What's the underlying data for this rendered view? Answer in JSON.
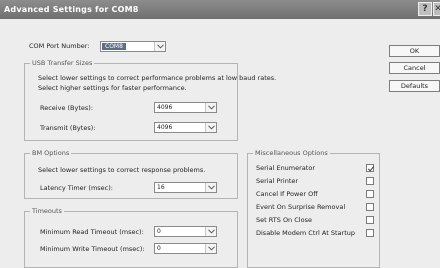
{
  "window": {
    "title": "Advanced Settings for COM8"
  },
  "titlebar_buttons": {
    "help": "?",
    "close": "✕"
  },
  "port": {
    "label": "COM Port Number:",
    "value": "COM8"
  },
  "usb": {
    "title": "USB Transfer Sizes",
    "desc1": "Select lower settings to correct performance problems at low baud rates.",
    "desc2": "Select higher settings for faster performance.",
    "receive_label": "Receive (Bytes):",
    "receive_value": "4096",
    "transmit_label": "Transmit (Bytes):",
    "transmit_value": "4096"
  },
  "bm": {
    "title": "BM Options",
    "desc": "Select lower settings to correct response problems.",
    "latency_label": "Latency Timer (msec):",
    "latency_value": "16"
  },
  "timeouts": {
    "title": "Timeouts",
    "read_label": "Minimum Read Timeout (msec):",
    "read_value": "0",
    "write_label": "Minimum Write Timeout (msec):",
    "write_value": "0"
  },
  "misc": {
    "title": "Miscellaneous Options",
    "options": [
      {
        "label": "Serial Enumerator",
        "checked": true
      },
      {
        "label": "Serial Printer",
        "checked": false
      },
      {
        "label": "Cancel If Power Off",
        "checked": false
      },
      {
        "label": "Event On Surprise Removal",
        "checked": false
      },
      {
        "label": "Set RTS On Close",
        "checked": false
      },
      {
        "label": "Disable Modem Ctrl At Startup",
        "checked": false
      }
    ]
  },
  "buttons": {
    "ok": "OK",
    "cancel": "Cancel",
    "defaults": "Defaults"
  }
}
